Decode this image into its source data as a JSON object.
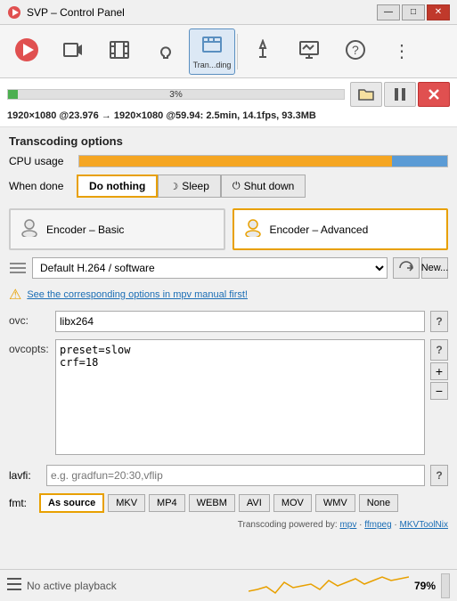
{
  "titleBar": {
    "title": "SVP – Control Panel",
    "minBtn": "—",
    "maxBtn": "□",
    "closeBtn": "✕"
  },
  "toolbar": {
    "items": [
      {
        "id": "logo",
        "icon": "🔴",
        "label": "",
        "active": false
      },
      {
        "id": "video",
        "icon": "🎬",
        "label": "",
        "active": false
      },
      {
        "id": "film",
        "icon": "🎞",
        "label": "",
        "active": false
      },
      {
        "id": "bulb",
        "icon": "💡",
        "label": "",
        "active": false
      },
      {
        "id": "transcode",
        "icon": "📽",
        "label": "Tran...ding",
        "active": true
      },
      {
        "id": "monitor",
        "icon": "🖥",
        "label": "",
        "active": false
      },
      {
        "id": "chart",
        "icon": "📊",
        "label": "",
        "active": false
      },
      {
        "id": "help",
        "icon": "❓",
        "label": "",
        "active": false
      },
      {
        "id": "more",
        "icon": "⋮",
        "label": "",
        "active": false
      }
    ]
  },
  "progress": {
    "percent": "3%",
    "percentNum": 3,
    "stats": "1920×1080 @23.976 → 1920×1080 @59.94:",
    "statsDetail": "2.5min, 14.1fps, 93.3MB",
    "folderIcon": "📁",
    "pauseIcon": "⏸",
    "stopIcon": "✕"
  },
  "transcoding": {
    "sectionTitle": "Transcoding options",
    "cpuLabel": "CPU usage",
    "cpuPercent": 85,
    "whenDoneLabel": "When done",
    "whenDoneButtons": [
      {
        "id": "do-nothing",
        "label": "Do nothing",
        "icon": "",
        "active": true
      },
      {
        "id": "sleep",
        "label": "Sleep",
        "icon": "☽",
        "active": false
      },
      {
        "id": "shutdown",
        "label": "Shut down",
        "icon": "⏻",
        "active": false
      }
    ]
  },
  "encoderTabs": [
    {
      "id": "basic",
      "icon": "🦁",
      "label": "Encoder – Basic",
      "active": false
    },
    {
      "id": "advanced",
      "icon": "🦁",
      "label": "Encoder – Advanced",
      "active": true
    }
  ],
  "preset": {
    "value": "Default H.264 / software",
    "placeholder": "Default H.264 / software",
    "replaceIcon": "⇄",
    "newLabel": "New...",
    "newIcon": "+"
  },
  "warning": {
    "text": "See the corresponding options in mpv manual first!"
  },
  "ovc": {
    "label": "ovc:",
    "value": "libx264",
    "helpLabel": "?"
  },
  "ovcopts": {
    "label": "ovcopts:",
    "value": "preset=slow\ncrf=18",
    "helpLabel": "?",
    "addLabel": "+",
    "removeLabel": "−"
  },
  "lavfi": {
    "label": "lavfi:",
    "placeholder": "e.g. gradfun=20:30,vflip",
    "helpLabel": "?"
  },
  "fmt": {
    "label": "fmt:",
    "buttons": [
      {
        "id": "as-source",
        "label": "As source",
        "active": true
      },
      {
        "id": "mkv",
        "label": "MKV",
        "active": false
      },
      {
        "id": "mp4",
        "label": "MP4",
        "active": false
      },
      {
        "id": "webm",
        "label": "WEBM",
        "active": false
      },
      {
        "id": "avi",
        "label": "AVI",
        "active": false
      },
      {
        "id": "mov",
        "label": "MOV",
        "active": false
      },
      {
        "id": "wmv",
        "label": "WMV",
        "active": false
      },
      {
        "id": "none",
        "label": "None",
        "active": false
      }
    ]
  },
  "poweredBy": {
    "text": "Transcoding powered by:",
    "links": [
      "mpv",
      "ffmpeg",
      "MKVToolNix"
    ]
  },
  "statusBar": {
    "text": "No active playback",
    "percent": "79%"
  }
}
